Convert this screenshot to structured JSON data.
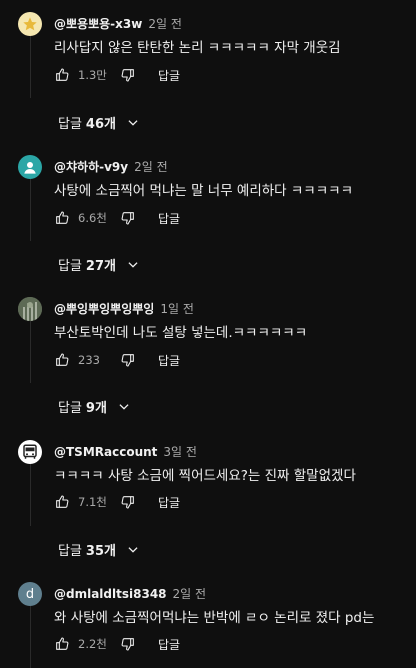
{
  "comments": [
    {
      "author": "@뽀용뽀용-x3w",
      "time": "2일 전",
      "text": "리사답지 않은 탄탄한 논리 ㅋㅋㅋㅋㅋ 자막 개웃김",
      "likes": "1.3만",
      "reply_label": "답글",
      "replies_prefix": "답글",
      "replies_count": "46개",
      "avatar_icon": "star-icon",
      "avatar_color": "#f5e7b0"
    },
    {
      "author": "@챠하하-v9y",
      "time": "2일 전",
      "text": "사탕에 소금찍어 먹냐는 말 너무 예리하다 ㅋㅋㅋㅋㅋ",
      "likes": "6.6천",
      "reply_label": "답글",
      "replies_prefix": "답글",
      "replies_count": "27개",
      "avatar_icon": "person-icon",
      "avatar_color": "#2ba6a6"
    },
    {
      "author": "@뿌잉뿌잉뿌잉뿌잉",
      "time": "1일 전",
      "text": "부산토박인데 나도 설탕 넣는데.ㅋㅋㅋㅋㅋㅋ",
      "likes": "233",
      "reply_label": "답글",
      "replies_prefix": "답글",
      "replies_count": "9개",
      "avatar_icon": "photo-avatar-icon",
      "avatar_color": "#6b7560"
    },
    {
      "author": "@TSMRaccount",
      "time": "3일 전",
      "text": "ㅋㅋㅋㅋ 사탕 소금에 찍어드세요?는 진짜 할말없겠다",
      "likes": "7.1천",
      "reply_label": "답글",
      "replies_prefix": "답글",
      "replies_count": "35개",
      "avatar_icon": "bus-icon",
      "avatar_color": "#ffffff"
    },
    {
      "author": "@dmlaldltsi8348",
      "time": "2일 전",
      "text": "와 사탕에 소금찍어먹냐는 반박에 ㄹㅇ 논리로 졌다 pd는",
      "likes": "2.2천",
      "reply_label": "답글",
      "avatar_icon": "letter-d-avatar",
      "avatar_letter": "d",
      "avatar_color": "#5f7f8e"
    }
  ]
}
